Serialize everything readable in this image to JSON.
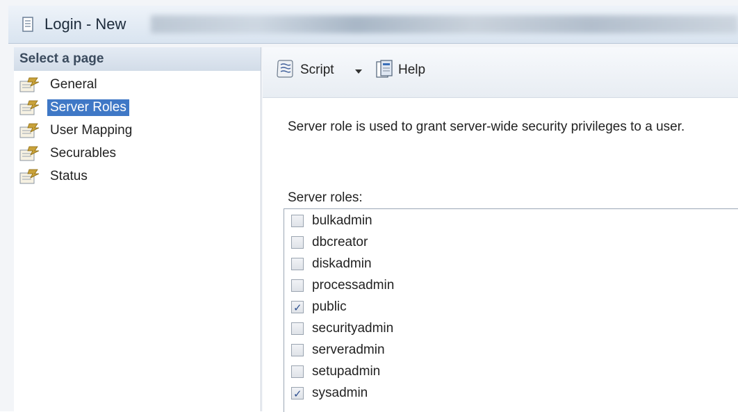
{
  "window": {
    "title": "Login - New"
  },
  "sidebar": {
    "header": "Select a page",
    "items": [
      {
        "label": "General",
        "selected": false
      },
      {
        "label": "Server Roles",
        "selected": true
      },
      {
        "label": "User Mapping",
        "selected": false
      },
      {
        "label": "Securables",
        "selected": false
      },
      {
        "label": "Status",
        "selected": false
      }
    ]
  },
  "toolbar": {
    "script_label": "Script",
    "help_label": "Help"
  },
  "main": {
    "description": "Server role is used to grant server-wide security privileges to a user.",
    "roles_label": "Server roles:",
    "roles": [
      {
        "name": "bulkadmin",
        "checked": false
      },
      {
        "name": "dbcreator",
        "checked": false
      },
      {
        "name": "diskadmin",
        "checked": false
      },
      {
        "name": "processadmin",
        "checked": false
      },
      {
        "name": "public",
        "checked": true
      },
      {
        "name": "securityadmin",
        "checked": false
      },
      {
        "name": "serveradmin",
        "checked": false
      },
      {
        "name": "setupadmin",
        "checked": false
      },
      {
        "name": "sysadmin",
        "checked": true
      }
    ]
  },
  "colors": {
    "selection": "#3f78c6",
    "check": "#2d4f8f"
  }
}
